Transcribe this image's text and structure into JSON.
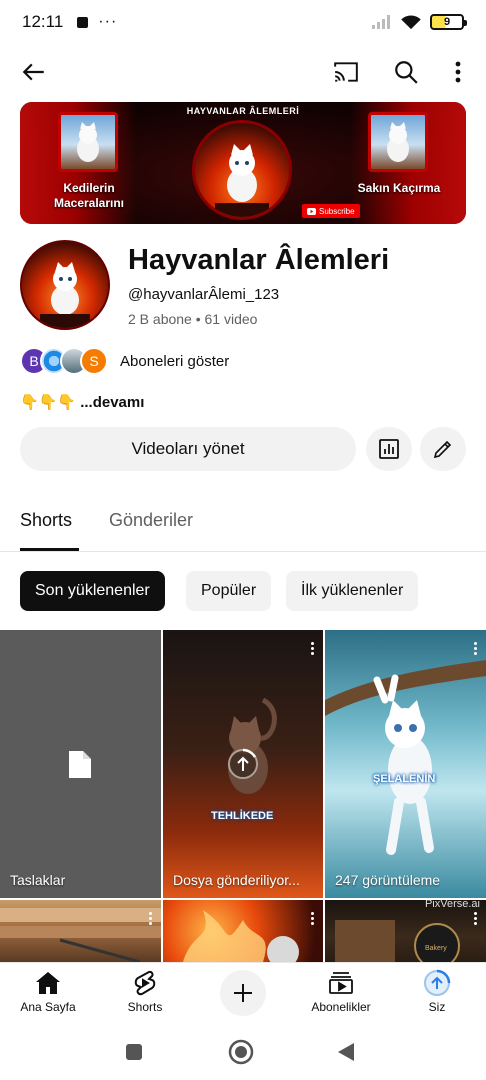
{
  "status_bar": {
    "time": "12:11",
    "battery": "9"
  },
  "banner": {
    "arc_title": "HAYVANLAR ÂLEMLERİ",
    "left_text": "Kedilerin Maceralarını",
    "right_text": "Sakın Kaçırma",
    "subscribe": "Subscribe"
  },
  "channel": {
    "name": "Hayvanlar Âlemleri",
    "handle": "@hayvanlarÂlemi_123",
    "meta": "2 B abone • 61 video",
    "subscriber_avatars": [
      {
        "letter": "B",
        "color": "#5e35b1"
      },
      {
        "letter": "",
        "color": "#1e88e5"
      },
      {
        "letter": "",
        "color": "#90a4ae"
      },
      {
        "letter": "S",
        "color": "#f57c00"
      }
    ],
    "subscribers_label": "Aboneleri göster",
    "description": "👇👇👇 ...devamı",
    "manage_button": "Videoları yönet"
  },
  "tabs": [
    {
      "label": "Shorts",
      "active": true
    },
    {
      "label": "Gönderiler",
      "active": false
    }
  ],
  "chips": [
    {
      "label": "Son yüklenenler",
      "active": true
    },
    {
      "label": "Popüler",
      "active": false
    },
    {
      "label": "İlk yüklenenler",
      "active": false
    }
  ],
  "shorts": [
    {
      "label": "Taslaklar"
    },
    {
      "label": "Dosya gönderiliyor...",
      "overlay_text": "TEHLİKEDE"
    },
    {
      "label": "247 görüntüleme",
      "overlay_text": "ŞELALENİN"
    },
    {
      "label": ""
    },
    {
      "label": ""
    },
    {
      "label": "",
      "watermark": "PixVerse.ai"
    }
  ],
  "bottom_nav": [
    {
      "label": "Ana Sayfa",
      "icon": "home-icon"
    },
    {
      "label": "Shorts",
      "icon": "shorts-icon"
    },
    {
      "label": "",
      "icon": "create-icon"
    },
    {
      "label": "Abonelikler",
      "icon": "subscriptions-icon"
    },
    {
      "label": "Siz",
      "icon": "profile-icon"
    }
  ],
  "colors": {
    "accent_red": "#ff0000",
    "chip_active": "#0f0f0f",
    "chip_bg": "#f2f2f2"
  }
}
